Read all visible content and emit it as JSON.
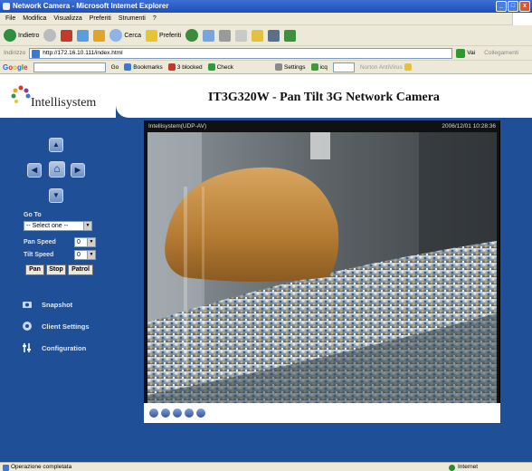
{
  "window": {
    "title": "Network Camera - Microsoft Internet Explorer",
    "buttons": [
      "_",
      "□",
      "x"
    ]
  },
  "menu": [
    "File",
    "Modifica",
    "Visualizza",
    "Preferiti",
    "Strumenti",
    "?"
  ],
  "toolbar": {
    "back": "Indietro",
    "search": "Cerca",
    "favorites": "Preferiti"
  },
  "address": {
    "label": "Indirizzo",
    "url": "http://172.16.10.111/index.html",
    "go": "Vai",
    "links": "Collegamenti"
  },
  "googlebar": {
    "logo": "Google",
    "go": "Go",
    "bookmarks": "Bookmarks",
    "blocked": "3 blocked",
    "check": "Check",
    "settings": "Settings",
    "icq": "icq",
    "antivirus": "Norton AntiVirus"
  },
  "header": {
    "logo_text": "Intellisystem",
    "title": "IT3G320W - Pan Tilt 3G Network Camera"
  },
  "ptz": {
    "up": "▲",
    "down": "▼",
    "left": "◀",
    "right": "▶",
    "home": "⌂"
  },
  "sidebar": {
    "goto_label": "Go To",
    "goto_value": "-- Select one --",
    "pan_speed_label": "Pan Speed",
    "pan_speed_value": "0",
    "tilt_speed_label": "Tilt Speed",
    "tilt_speed_value": "0",
    "btn_pan": "Pan",
    "btn_stop": "Stop",
    "btn_patrol": "Patrol",
    "links": [
      {
        "label": "Snapshot",
        "icon": "camera-icon"
      },
      {
        "label": "Client Settings",
        "icon": "client-settings-icon"
      },
      {
        "label": "Configuration",
        "icon": "configuration-icon"
      }
    ]
  },
  "video": {
    "source": "Intellisystem(UDP-AV)",
    "timestamp": "2006/12/01 10:28:36"
  },
  "status": {
    "text": "Operazione completata",
    "zone": "Internet"
  }
}
